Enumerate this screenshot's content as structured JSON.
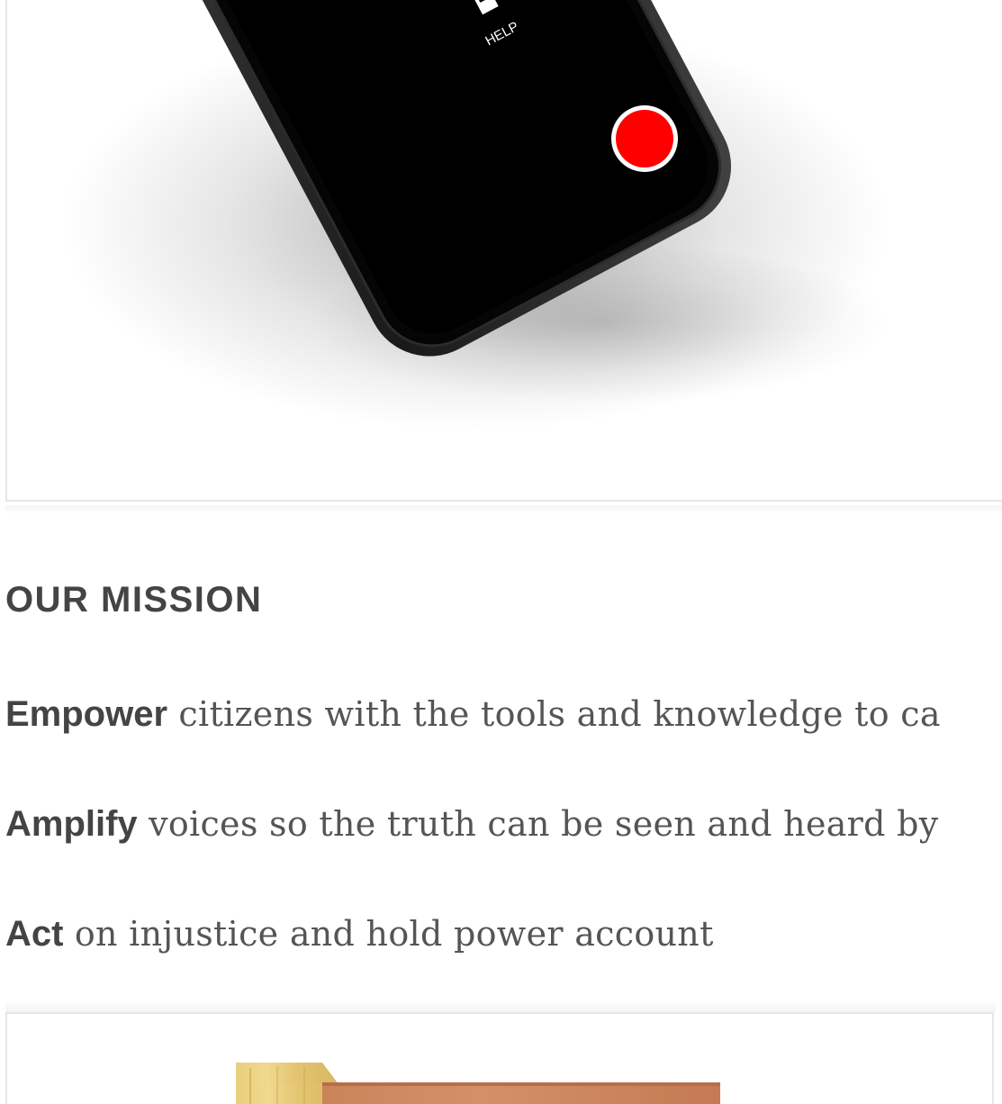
{
  "hero_image": {
    "phone_label": "HELP",
    "record_button_color": "#ff0000"
  },
  "mission": {
    "heading": "OUR MISSION",
    "items": [
      {
        "keyword": "Empower",
        "text": " citizens with the tools and knowledge to ca"
      },
      {
        "keyword": "Amplify",
        "text": " voices so the truth can be seen and heard by"
      },
      {
        "keyword": "Act",
        "text": " on injustice and hold power account"
      }
    ]
  },
  "colors": {
    "heading": "#444444",
    "body_text": "#555555",
    "card_border": "#e6e6e6",
    "record_red": "#ff0000"
  }
}
